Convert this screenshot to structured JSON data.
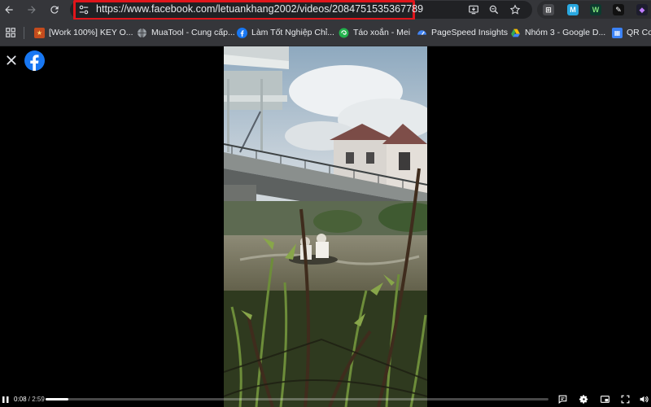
{
  "browser": {
    "url": "https://www.facebook.com/letuankhang2002/videos/2084751535367789",
    "bookmarks": [
      {
        "label": "[Work 100%] KEY O...",
        "icon": "work-favicon"
      },
      {
        "label": "MuaTool - Cung cấp...",
        "icon": "globe-icon"
      },
      {
        "label": "Làm Tốt Nghiệp Chỉ...",
        "icon": "facebook-icon"
      },
      {
        "label": "Táo xoắn - Mei",
        "icon": "green-swirl-favicon"
      },
      {
        "label": "PageSpeed Insights",
        "icon": "pagespeed-icon"
      },
      {
        "label": "Nhóm 3 - Google D...",
        "icon": "google-drive-icon"
      },
      {
        "label": "QR Coc",
        "icon": "qr-favicon"
      }
    ],
    "extensions": [
      "translate-extension",
      "m-extension",
      "w-extension",
      "pen-extension",
      "media-extension"
    ]
  },
  "player": {
    "current_time": "0:08",
    "separator": " / ",
    "duration": "2:59",
    "progress": 0.045
  },
  "colors": {
    "highlight": "#e0151b",
    "facebook_blue": "#1877f2",
    "toolbar": "#35363a"
  }
}
